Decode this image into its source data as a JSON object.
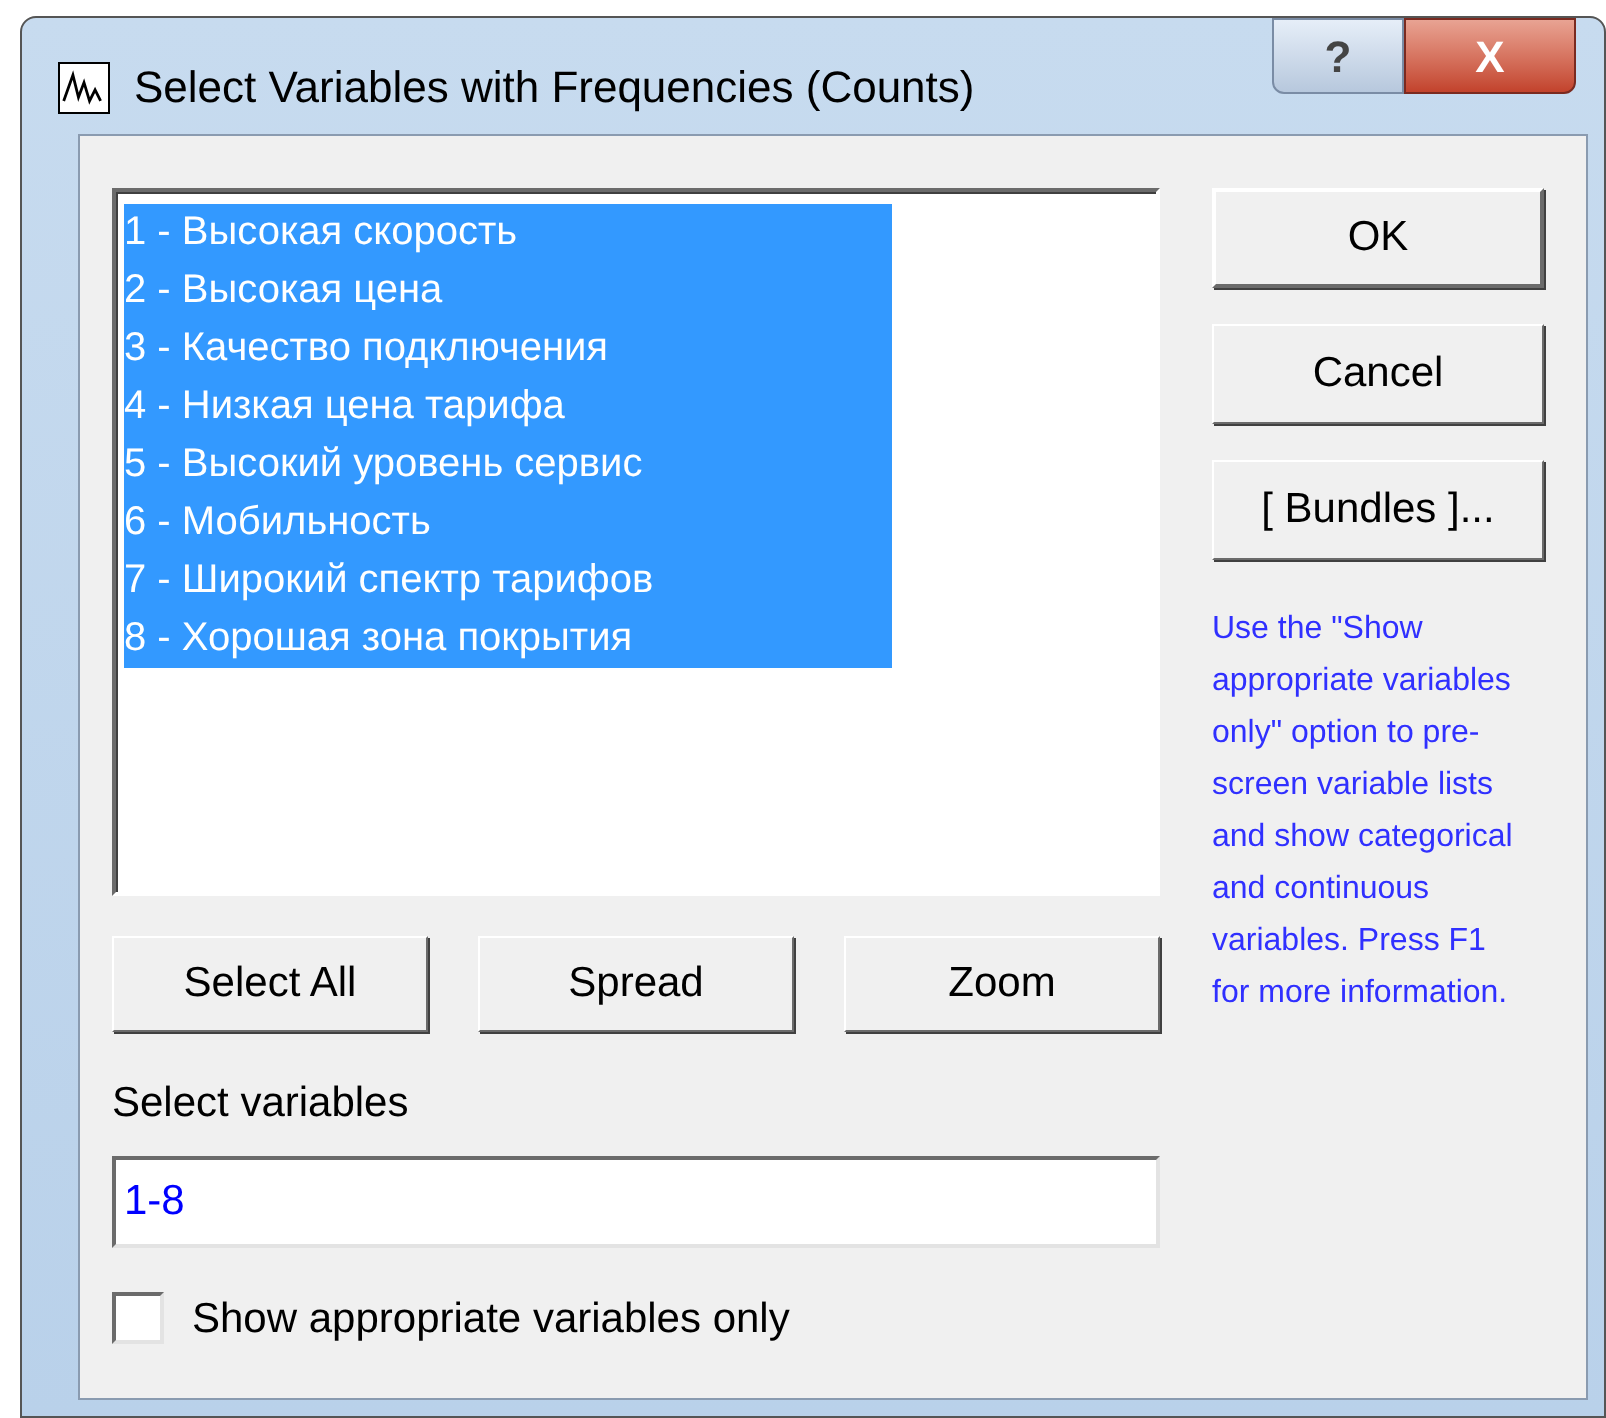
{
  "window": {
    "title": "Select Variables with Frequencies (Counts)",
    "help_button": "?",
    "close_button": "X"
  },
  "variables": [
    {
      "label": "1 - Высокая скорость",
      "selected": true
    },
    {
      "label": "2 - Высокая цена",
      "selected": true
    },
    {
      "label": "3 - Качество подключения",
      "selected": true
    },
    {
      "label": "4 - Низкая цена тарифа",
      "selected": true
    },
    {
      "label": "5 - Высокий уровень сервис",
      "selected": true
    },
    {
      "label": "6 - Мобильность",
      "selected": true
    },
    {
      "label": "7 - Широкий спектр тарифов",
      "selected": true
    },
    {
      "label": "8 - Хорошая зона покрытия",
      "selected": true
    }
  ],
  "side_buttons": [
    "OK",
    "Cancel",
    "[ Bundles ]..."
  ],
  "help_text": "Use the \"Show appropriate variables only\" option to pre-screen variable lists and show categorical and continuous variables. Press F1 for more information.",
  "list_buttons": [
    "Select All",
    "Spread",
    "Zoom"
  ],
  "select_label": "Select variables",
  "select_value": "1-8",
  "show_appropriate": {
    "label": "Show appropriate variables only",
    "checked": false
  }
}
